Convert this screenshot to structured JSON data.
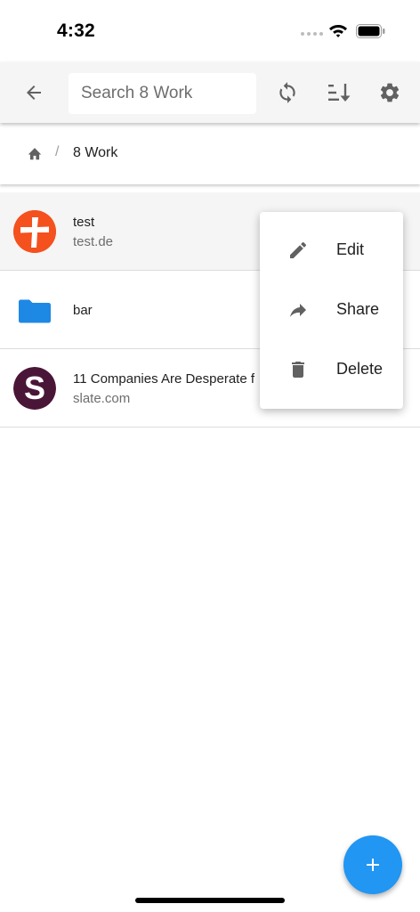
{
  "status_bar": {
    "time": "4:32"
  },
  "toolbar": {
    "search_placeholder": "Search 8 Work",
    "icons": {
      "back": "arrow-back-icon",
      "sync": "sync-icon",
      "sort": "sort-icon",
      "settings": "gear-icon"
    }
  },
  "breadcrumb": {
    "separator": "/",
    "current": "8 Work",
    "home_icon": "home-icon"
  },
  "items": [
    {
      "title": "test",
      "subtitle": "test.de",
      "icon": "cross-logo-icon",
      "color": "#f4511e"
    },
    {
      "title": "bar",
      "subtitle": "",
      "icon": "folder-icon",
      "color": "#1e88e5"
    },
    {
      "title": "11 Companies Are Desperate f",
      "subtitle": "slate.com",
      "icon": "slate-logo-icon",
      "color": "#4a1637"
    }
  ],
  "menu": [
    {
      "label": "Edit",
      "icon": "pencil-icon"
    },
    {
      "label": "Share",
      "icon": "share-icon"
    },
    {
      "label": "Delete",
      "icon": "trash-icon"
    }
  ],
  "fab": {
    "icon": "plus-icon",
    "color": "#2196f3"
  }
}
